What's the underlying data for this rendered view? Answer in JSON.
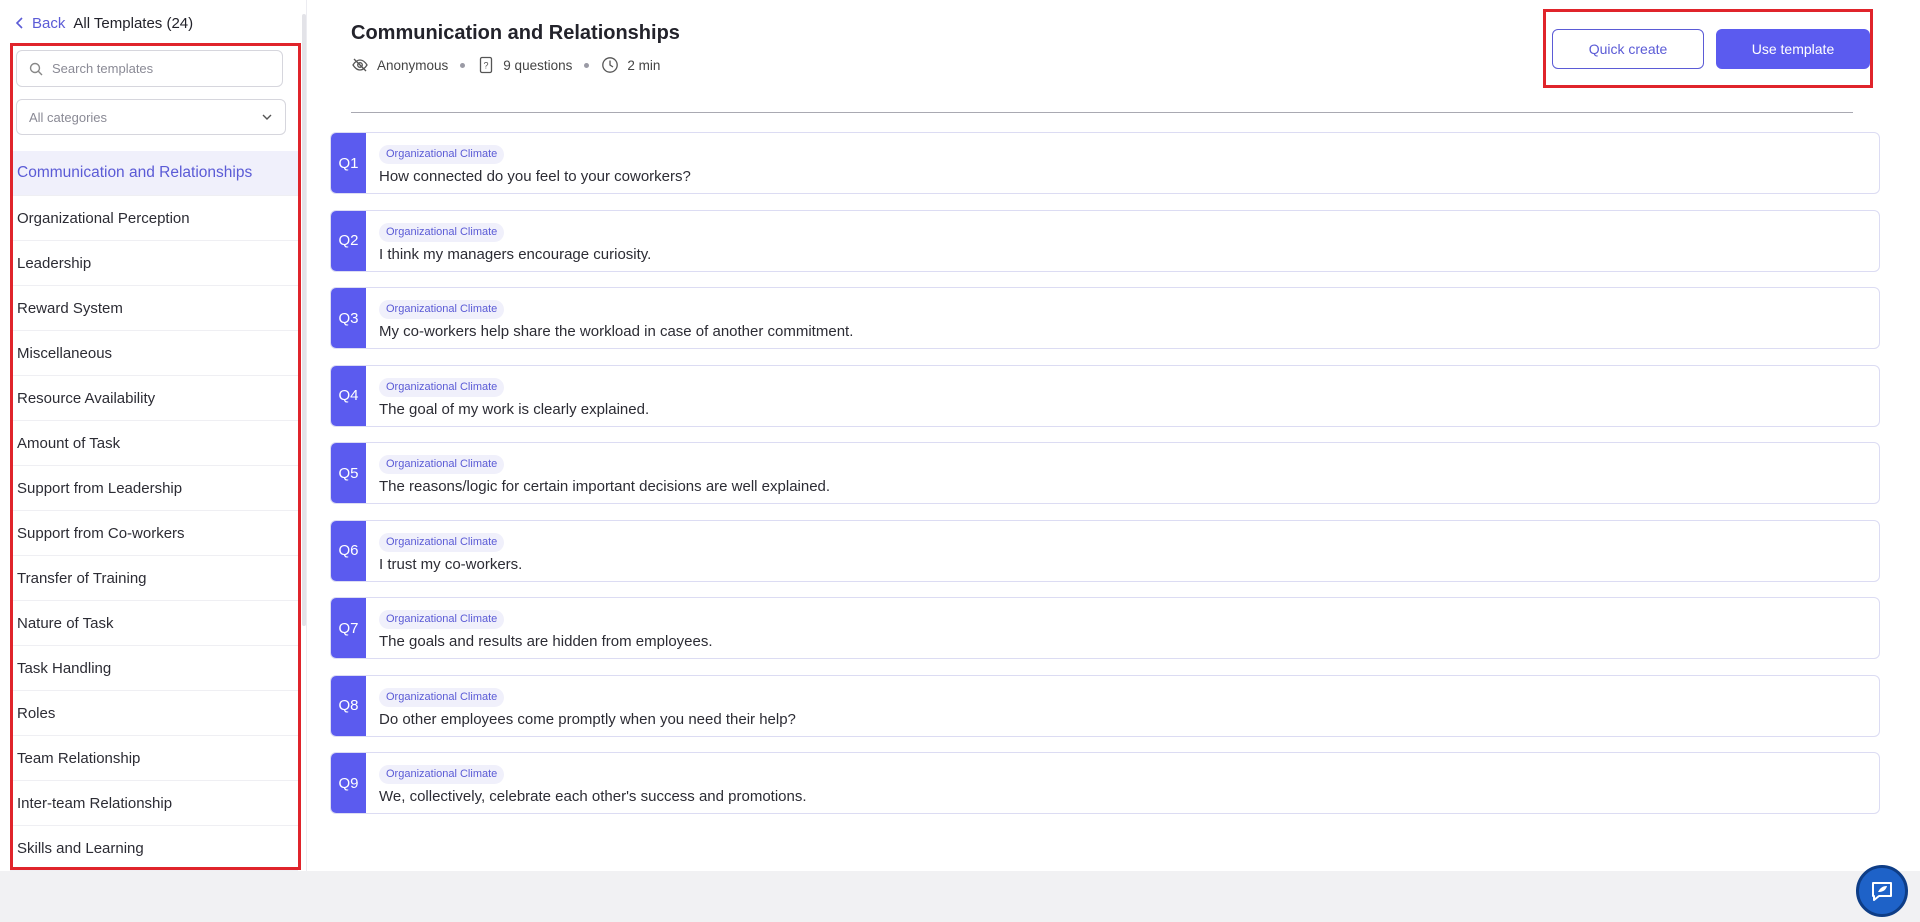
{
  "sidebar": {
    "back_label": "Back",
    "all_templates_label": "All Templates (24)",
    "search_placeholder": "Search templates",
    "category_select_value": "All categories",
    "categories": [
      "Communication and Relationships",
      "Organizational Perception",
      "Leadership",
      "Reward System",
      "Miscellaneous",
      "Resource Availability",
      "Amount of Task",
      "Support from Leadership",
      "Support from Co-workers",
      "Transfer of Training",
      "Nature of Task",
      "Task Handling",
      "Roles",
      "Team Relationship",
      "Inter-team Relationship",
      "Skills and Learning"
    ],
    "active_index": 0
  },
  "template": {
    "title": "Communication and Relationships",
    "meta": {
      "privacy": "Anonymous",
      "question_count": "9 questions",
      "duration": "2 min"
    },
    "quick_create_label": "Quick create",
    "use_template_label": "Use template"
  },
  "questions": [
    {
      "num": "Q1",
      "tag": "Organizational Climate",
      "text": "How connected do you feel to your coworkers?"
    },
    {
      "num": "Q2",
      "tag": "Organizational Climate",
      "text": "I think my managers encourage curiosity."
    },
    {
      "num": "Q3",
      "tag": "Organizational Climate",
      "text": "My co-workers help share the workload in case of another commitment."
    },
    {
      "num": "Q4",
      "tag": "Organizational Climate",
      "text": "The goal of my work is clearly explained."
    },
    {
      "num": "Q5",
      "tag": "Organizational Climate",
      "text": "The reasons/logic for certain important decisions are well explained."
    },
    {
      "num": "Q6",
      "tag": "Organizational Climate",
      "text": "I trust my co-workers."
    },
    {
      "num": "Q7",
      "tag": "Organizational Climate",
      "text": "The goals and results are hidden from employees."
    },
    {
      "num": "Q8",
      "tag": "Organizational Climate",
      "text": "Do other employees come promptly when you need their help?"
    },
    {
      "num": "Q9",
      "tag": "Organizational Climate",
      "text": "We, collectively, celebrate each other's success and promotions."
    }
  ],
  "colors": {
    "accent": "#5b5bef",
    "highlight_border": "#e0242b"
  }
}
